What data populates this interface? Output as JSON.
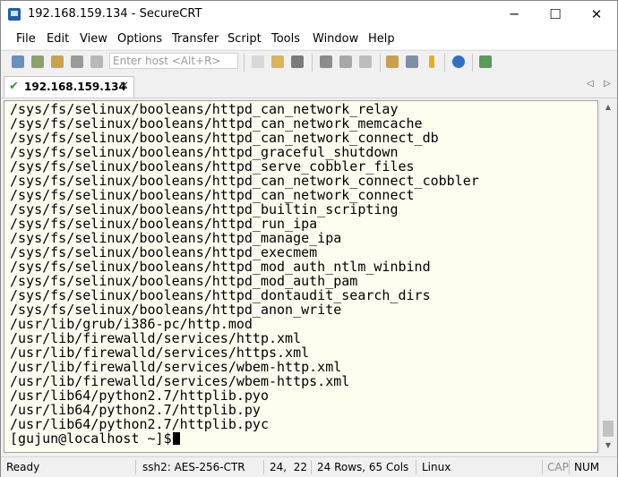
{
  "window": {
    "title": "192.168.159.134 - SecureCRT"
  },
  "window_controls": {
    "minimize": "─",
    "maximize": "☐",
    "close": "✕"
  },
  "menu": [
    "File",
    "Edit",
    "View",
    "Options",
    "Transfer",
    "Script",
    "Tools",
    "Window",
    "Help"
  ],
  "toolbar": {
    "host_placeholder": "Enter host <Alt+R>"
  },
  "tab": {
    "label": "192.168.159.134",
    "check": "✔",
    "close": "✕"
  },
  "tab_nav": {
    "left": "◁",
    "right": "▷"
  },
  "terminal": {
    "lines": [
      "/sys/fs/selinux/booleans/httpd_can_network_relay",
      "/sys/fs/selinux/booleans/httpd_can_network_memcache",
      "/sys/fs/selinux/booleans/httpd_can_network_connect_db",
      "/sys/fs/selinux/booleans/httpd_graceful_shutdown",
      "/sys/fs/selinux/booleans/httpd_serve_cobbler_files",
      "/sys/fs/selinux/booleans/httpd_can_network_connect_cobbler",
      "/sys/fs/selinux/booleans/httpd_can_network_connect",
      "/sys/fs/selinux/booleans/httpd_builtin_scripting",
      "/sys/fs/selinux/booleans/httpd_run_ipa",
      "/sys/fs/selinux/booleans/httpd_manage_ipa",
      "/sys/fs/selinux/booleans/httpd_execmem",
      "/sys/fs/selinux/booleans/httpd_mod_auth_ntlm_winbind",
      "/sys/fs/selinux/booleans/httpd_mod_auth_pam",
      "/sys/fs/selinux/booleans/httpd_dontaudit_search_dirs",
      "/sys/fs/selinux/booleans/httpd_anon_write",
      "/usr/lib/grub/i386-pc/http.mod",
      "/usr/lib/firewalld/services/http.xml",
      "/usr/lib/firewalld/services/https.xml",
      "/usr/lib/firewalld/services/wbem-http.xml",
      "/usr/lib/firewalld/services/wbem-https.xml",
      "/usr/lib64/python2.7/httplib.pyo",
      "/usr/lib64/python2.7/httplib.py",
      "/usr/lib64/python2.7/httplib.pyc",
      "[gujun@localhost ~]$"
    ]
  },
  "scrollbar": {
    "up": "▲",
    "down": "▼"
  },
  "status": {
    "ready": "Ready",
    "protocol": "ssh2: AES-256-CTR",
    "cursor_pos": "24,  22",
    "dimensions": "24 Rows, 65 Cols",
    "term_type": "Linux",
    "cap": "CAP",
    "num": "NUM"
  },
  "colors": {
    "terminal_bg": "#fefdf0",
    "tab_check": "#2a9d2a",
    "titlebar_bg": "#ffffff"
  }
}
